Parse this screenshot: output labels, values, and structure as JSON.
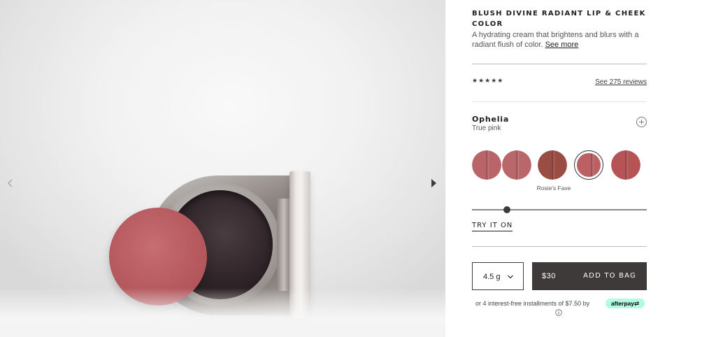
{
  "gallery": {
    "prev_icon": "chevron-left-icon",
    "next_icon": "chevron-right-icon"
  },
  "product": {
    "title": "BLUSH DIVINE RADIANT LIP & CHEEK COLOR",
    "description": "A hydrating cream that brightens and blurs with a radiant flush of color.",
    "see_more": "See more"
  },
  "rating": {
    "stars_text": "★★★★★",
    "value": 5,
    "max": 5,
    "reviews_link": "See 275 reviews"
  },
  "shade": {
    "name": "Ophelia",
    "description": "True pink",
    "expand_icon": "plus-circle-icon",
    "swatches": [
      {
        "color": "#b86468"
      },
      {
        "color": "#b9676a"
      },
      {
        "color": "#9a4d43"
      },
      {
        "color": "#bb6063",
        "selected": true
      },
      {
        "color": "#b55356"
      }
    ],
    "selected_caption": "Rosie's Fave",
    "scroll_position": 0.2
  },
  "try_on": "TRY IT ON",
  "size": {
    "value": "4.5 g",
    "icon": "chevron-down-icon"
  },
  "cart": {
    "price": "$30",
    "add_label": "ADD TO BAG"
  },
  "financing": {
    "text": "or 4 interest-free installments of $7.50 by",
    "provider": "afterpay",
    "provider_icon": "afterpay-arrows-icon",
    "info_icon": "info-icon",
    "badge_color": "#b2fce4"
  },
  "colors": {
    "button": "#3e3a39",
    "text": "#1e1e1e"
  }
}
